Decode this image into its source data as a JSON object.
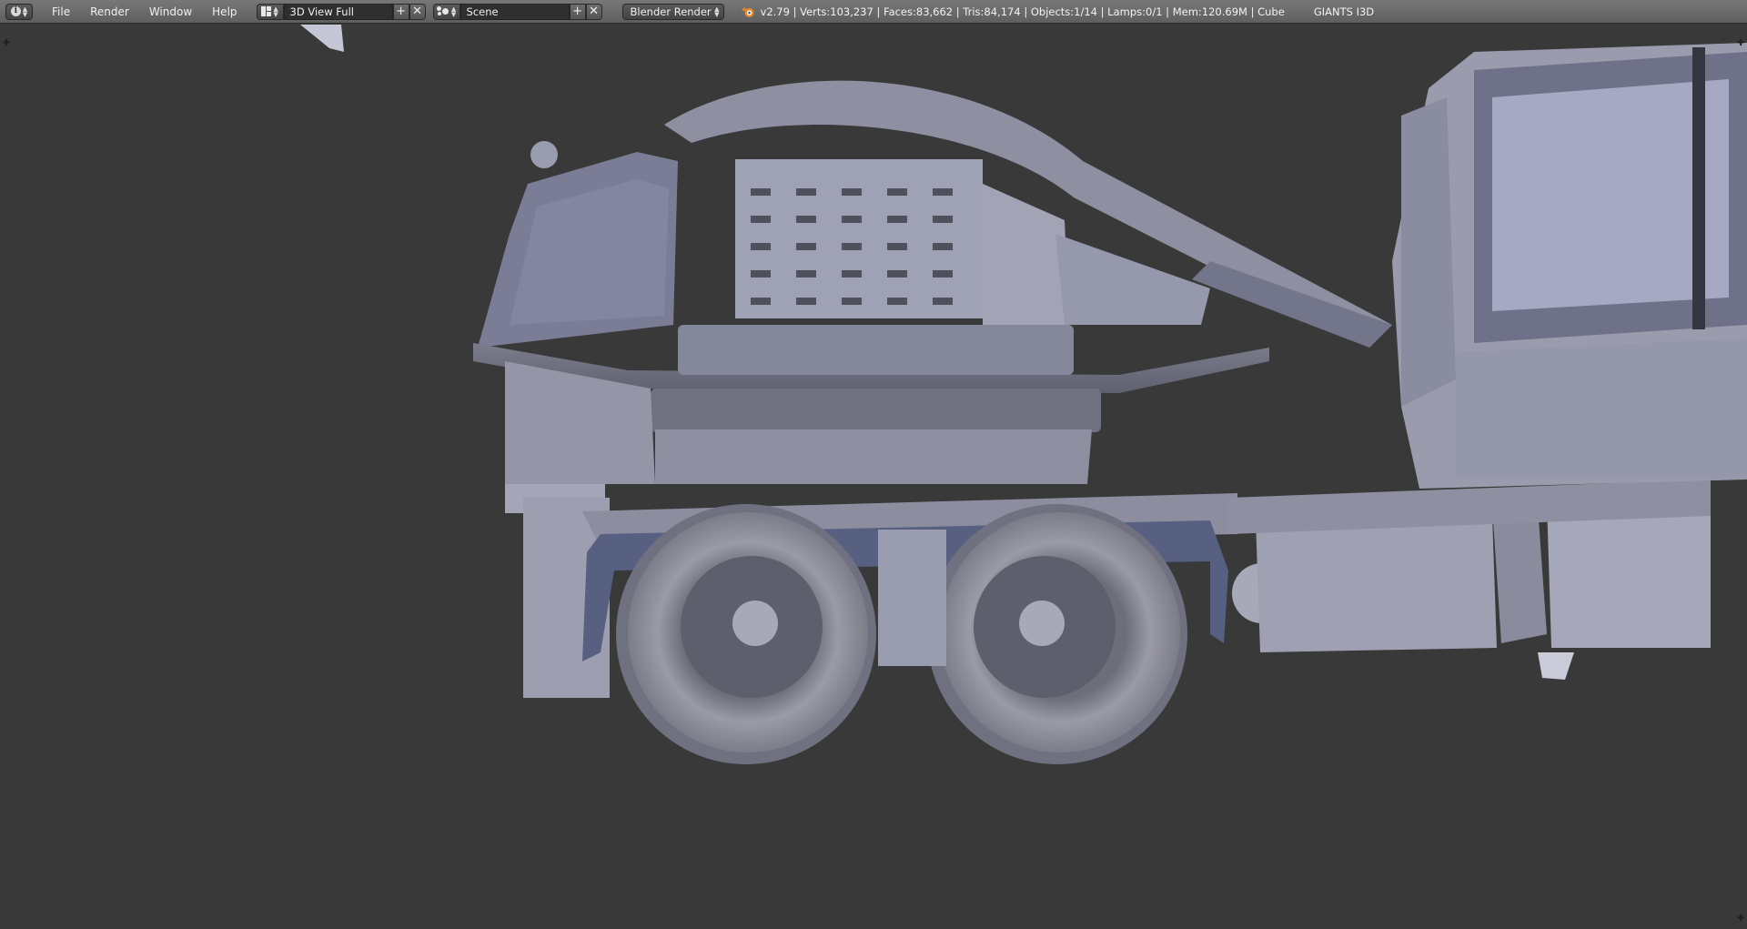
{
  "header": {
    "info_icon": "info-icon",
    "menus": [
      "File",
      "Render",
      "Window",
      "Help"
    ],
    "screen_layout": {
      "icon": "screen-layout-icon",
      "value": "3D View Full"
    },
    "scene": {
      "icon": "scene-icon",
      "value": "Scene"
    },
    "render_engine": "Blender Render",
    "stats": "v2.79 | Verts:103,237 | Faces:83,662 | Tris:84,174 | Objects:1/14 | Lamps:0/1 | Mem:120.69M | Cube",
    "addon_label": "GIANTS I3D"
  },
  "viewport": {
    "subject": "3d-model-truck-with-chipper",
    "colors": {
      "background": "#393939",
      "model": "#9a9cb0"
    }
  }
}
